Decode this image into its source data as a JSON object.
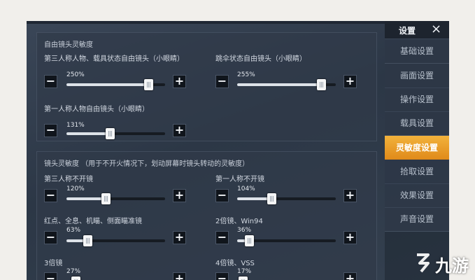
{
  "sidebar": {
    "title": "设置",
    "items": [
      {
        "label": "基础设置",
        "active": false
      },
      {
        "label": "画面设置",
        "active": false
      },
      {
        "label": "操作设置",
        "active": false
      },
      {
        "label": "载具设置",
        "active": false
      },
      {
        "label": "灵敏度设置",
        "active": true
      },
      {
        "label": "拾取设置",
        "active": false
      },
      {
        "label": "效果设置",
        "active": false
      },
      {
        "label": "声音设置",
        "active": false
      }
    ]
  },
  "free_camera": {
    "title": "自由镜头灵敏度",
    "sliders": [
      {
        "label": "第三人称人物、载具状态自由镜头（小眼睛）",
        "value_text": "250%",
        "fraction": 0.83
      },
      {
        "label": "跳伞状态自由镜头（小眼睛）",
        "value_text": "255%",
        "fraction": 0.85
      },
      {
        "label": "第一人称人物自由镜头（小眼睛）",
        "value_text": "131%",
        "fraction": 0.44
      }
    ]
  },
  "camera": {
    "title": "镜头灵敏度  （用于不开火情况下，划动屏幕时镜头转动的灵敏度）",
    "sliders": [
      {
        "label": "第三人称不开镜",
        "value_text": "120%",
        "fraction": 0.4
      },
      {
        "label": "第一人称不开镜",
        "value_text": "104%",
        "fraction": 0.35
      },
      {
        "label": "红点、全息、机瞄、侧面瞄准镜",
        "value_text": "63%",
        "fraction": 0.21
      },
      {
        "label": "2倍镜、Win94",
        "value_text": "36%",
        "fraction": 0.12
      },
      {
        "label": "3倍镜",
        "value_text": "27%",
        "fraction": 0.09
      },
      {
        "label": "4倍镜、VSS",
        "value_text": "17%",
        "fraction": 0.06
      }
    ]
  },
  "controls": {
    "minus": "−",
    "plus": "+"
  },
  "close_icon": "×",
  "watermark": {
    "text": "九游"
  }
}
